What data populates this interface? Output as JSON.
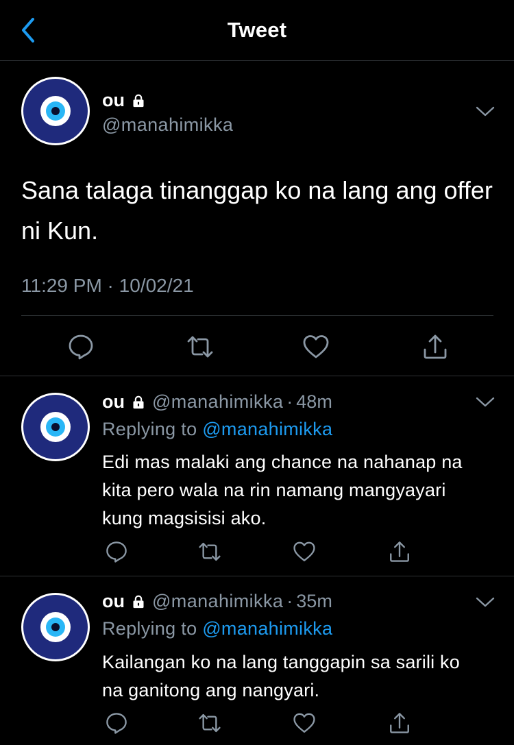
{
  "header": {
    "title": "Tweet",
    "back_icon": "chevron-left-icon",
    "accent": "#1d9bf0"
  },
  "main_tweet": {
    "name": "ou",
    "handle": "@manahimikka",
    "text": "Sana talaga tinanggap ko na lang ang offer ni Kun.",
    "time": "11:29 PM · 10/02/21"
  },
  "replies": [
    {
      "name": "ou",
      "handle": "@manahimikka",
      "sep": "·",
      "age": "48m",
      "replying_prefix": "Replying to",
      "replying_to": "@manahimikka",
      "text": "Edi mas malaki ang chance na nahanap na kita pero wala na rin namang mangyayari kung magsisisi ako."
    },
    {
      "name": "ou",
      "handle": "@manahimikka",
      "sep": "·",
      "age": "35m",
      "replying_prefix": "Replying to",
      "replying_to": "@manahimikka",
      "text": "Kailangan ko na lang tanggapin sa sarili ko na ganitong ang nangyari."
    }
  ],
  "colors": {
    "background": "#000000",
    "text": "#ffffff",
    "muted": "#8b98a5",
    "divider": "#2f3336",
    "avatar_ring": "#1a237e",
    "avatar_eye": "#29b6f6"
  }
}
